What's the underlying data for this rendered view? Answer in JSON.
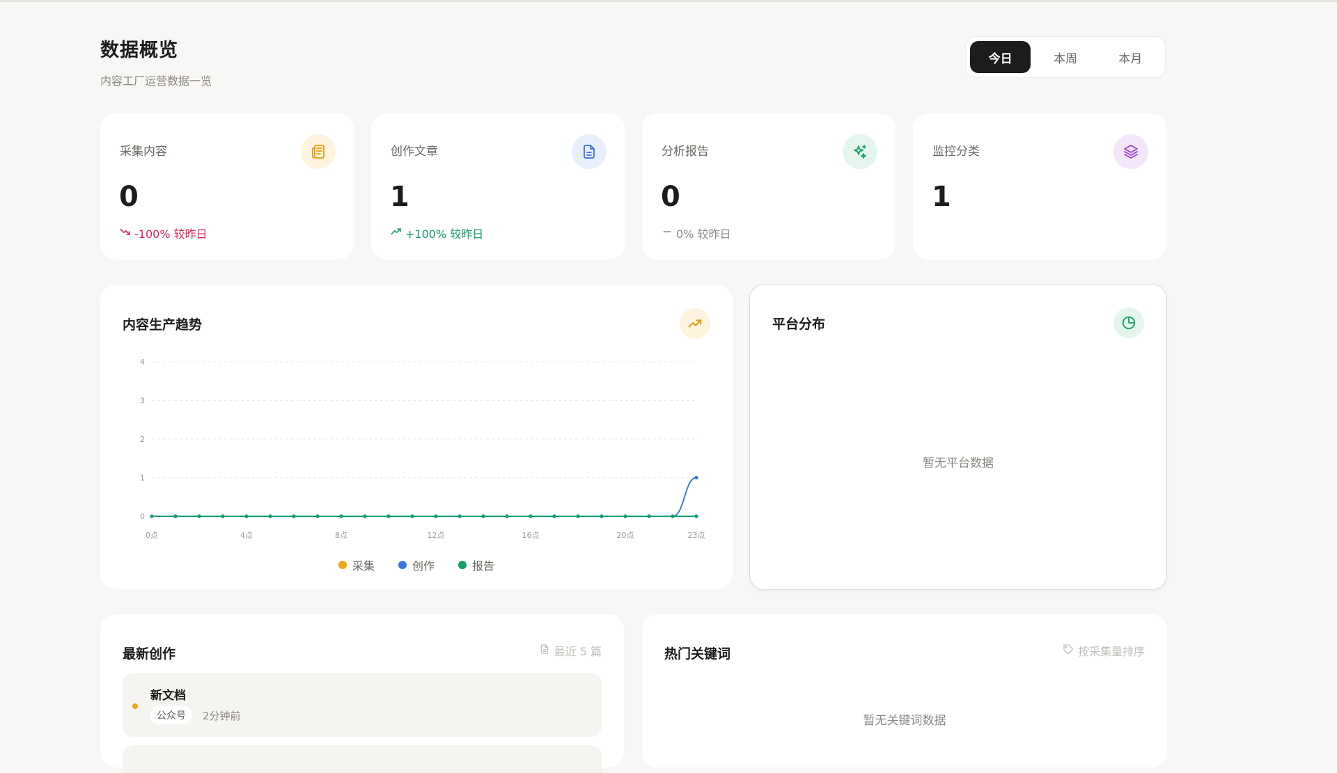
{
  "header": {
    "title": "数据概览",
    "subtitle": "内容工厂运营数据一览"
  },
  "range_tabs": [
    {
      "label": "今日",
      "active": true
    },
    {
      "label": "本周",
      "active": false
    },
    {
      "label": "本月",
      "active": false
    }
  ],
  "stats": [
    {
      "label": "采集内容",
      "value": "0",
      "change": "-100% 较昨日",
      "trend": "down",
      "icon": "newspaper-icon",
      "accent": "#f0a515",
      "change_color": "#e0244f"
    },
    {
      "label": "创作文章",
      "value": "1",
      "change": "+100% 较昨日",
      "trend": "up",
      "icon": "document-icon",
      "accent": "#3b6fd8",
      "change_color": "#16a06a"
    },
    {
      "label": "分析报告",
      "value": "0",
      "change": "0% 较昨日",
      "trend": "flat",
      "icon": "sparkles-icon",
      "accent": "#16a06a",
      "change_color": "#8c8984"
    },
    {
      "label": "监控分类",
      "value": "1",
      "change": "",
      "trend": "none",
      "icon": "layers-icon",
      "accent": "#9b3fd6",
      "change_color": "#8c8984"
    }
  ],
  "trend_panel": {
    "title": "内容生产趋势",
    "icon": "trending-up-icon"
  },
  "chart_data": {
    "type": "line",
    "x": [
      "0点",
      "1点",
      "2点",
      "3点",
      "4点",
      "5点",
      "6点",
      "7点",
      "8点",
      "9点",
      "10点",
      "11点",
      "12点",
      "13点",
      "14点",
      "15点",
      "16点",
      "17点",
      "18点",
      "19点",
      "20点",
      "21点",
      "22点",
      "23点"
    ],
    "x_tick_labels": [
      "0点",
      "4点",
      "8点",
      "12点",
      "16点",
      "20点",
      "23点"
    ],
    "y_ticks": [
      0,
      1,
      2,
      3,
      4
    ],
    "ylim": [
      0,
      4
    ],
    "grid": true,
    "legend_position": "bottom",
    "series": [
      {
        "name": "采集",
        "color": "#f0a515",
        "values": [
          0,
          0,
          0,
          0,
          0,
          0,
          0,
          0,
          0,
          0,
          0,
          0,
          0,
          0,
          0,
          0,
          0,
          0,
          0,
          0,
          0,
          0,
          0,
          0
        ]
      },
      {
        "name": "创作",
        "color": "#3b78e7",
        "values": [
          0,
          0,
          0,
          0,
          0,
          0,
          0,
          0,
          0,
          0,
          0,
          0,
          0,
          0,
          0,
          0,
          0,
          0,
          0,
          0,
          0,
          0,
          0,
          1
        ]
      },
      {
        "name": "报告",
        "color": "#16a06a",
        "values": [
          0,
          0,
          0,
          0,
          0,
          0,
          0,
          0,
          0,
          0,
          0,
          0,
          0,
          0,
          0,
          0,
          0,
          0,
          0,
          0,
          0,
          0,
          0,
          0
        ]
      }
    ]
  },
  "platform_panel": {
    "title": "平台分布",
    "icon": "pie-chart-icon",
    "empty": "暂无平台数据"
  },
  "latest_panel": {
    "title": "最新创作",
    "meta": "最近 5 篇",
    "items": [
      {
        "title": "新文档",
        "tag": "公众号",
        "time": "2分钟前"
      }
    ]
  },
  "keywords_panel": {
    "title": "热门关键词",
    "meta": "按采集量排序",
    "empty": "暂无关键词数据"
  }
}
